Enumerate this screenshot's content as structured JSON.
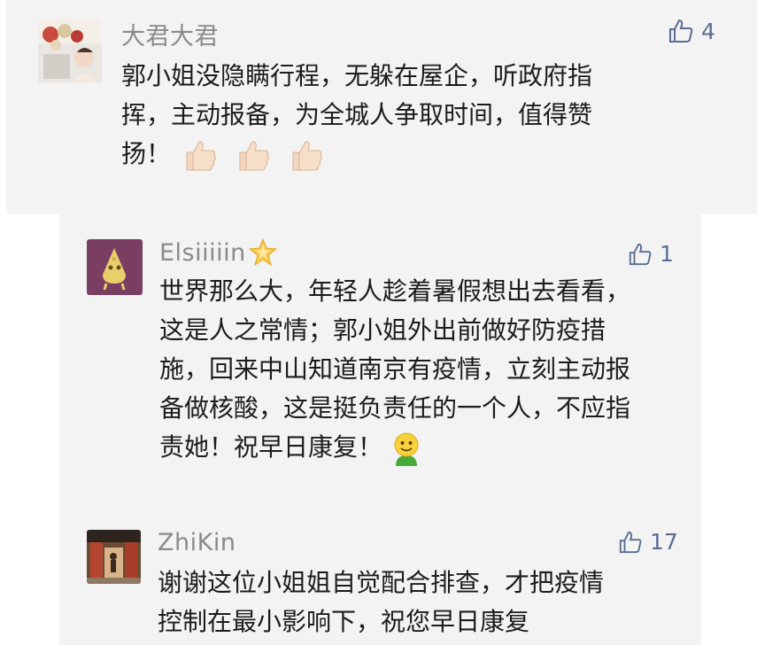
{
  "comments": [
    {
      "name": "大君大君",
      "likes": "4",
      "lines": [
        "郭小姐没隐瞒行程，无躲在屋企，听政府指",
        "挥，主动报备，为全城人争取时间，值得赞",
        "扬！"
      ],
      "trailing_emoji": [
        "thumbs-up",
        "thumbs-up",
        "thumbs-up"
      ]
    },
    {
      "name": "Elsiiiiin",
      "likes": "1",
      "lines": [
        "世界那么大，年轻人趁着暑假想出去看看，",
        "这是人之常情；郭小姐外出前做好防疫措",
        "施，回来中山知道南京有疫情，立刻主动报",
        "备做核酸，这是挺负责任的一个人，不应指",
        "责她！祝早日康复！"
      ],
      "trailing_emoji": [
        "smiling-green-face"
      ]
    },
    {
      "name": "ZhiKin",
      "likes": "17",
      "lines": [
        "谢谢这位小姐姐自觉配合排查，才把疫情",
        "控制在最小影响下，祝您早日康复"
      ]
    }
  ],
  "colors": {
    "panel_bg": "#f3f3f3",
    "name": "#8a8a8a",
    "like": "#5b6d93",
    "text": "#1c1c1c"
  }
}
